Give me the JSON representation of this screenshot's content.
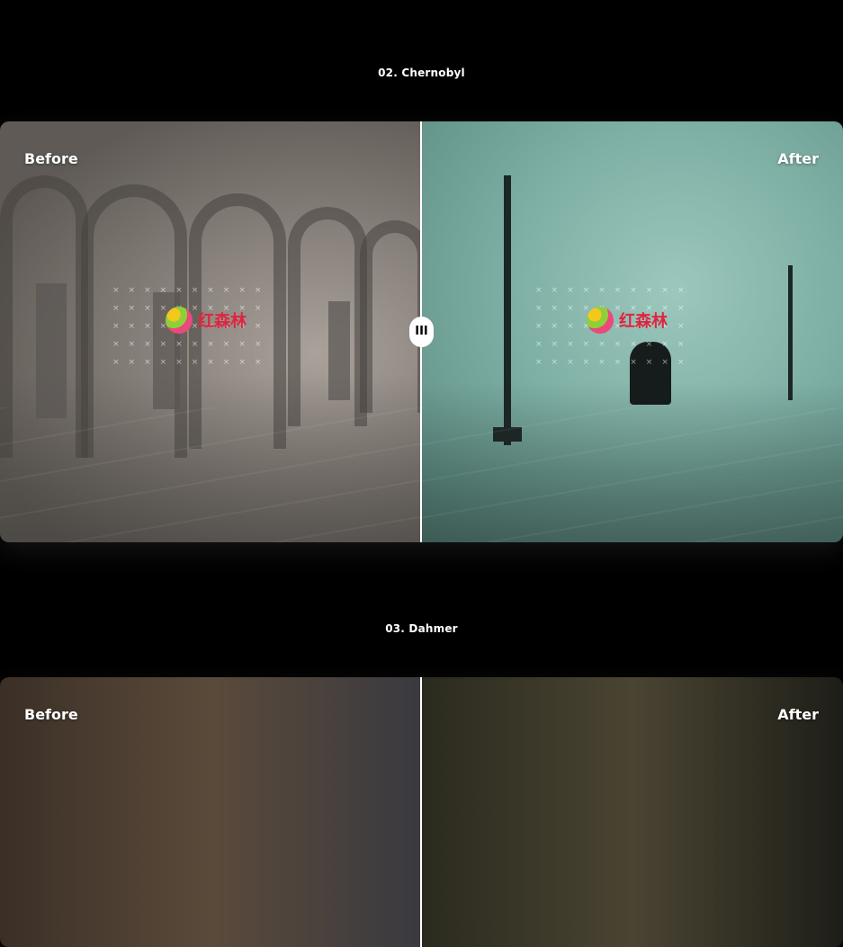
{
  "sections": [
    {
      "title": "02. Chernobyl",
      "before_label": "Before",
      "after_label": "After",
      "handle_icon": "drag-handle-icon",
      "handle_glyph": "III"
    },
    {
      "title": "03. Dahmer",
      "before_label": "Before",
      "after_label": "After"
    }
  ],
  "watermark": {
    "text": "红森林"
  },
  "colors": {
    "background": "#000000",
    "divider": "#ffffff",
    "watermark_text": "#e0243f"
  }
}
